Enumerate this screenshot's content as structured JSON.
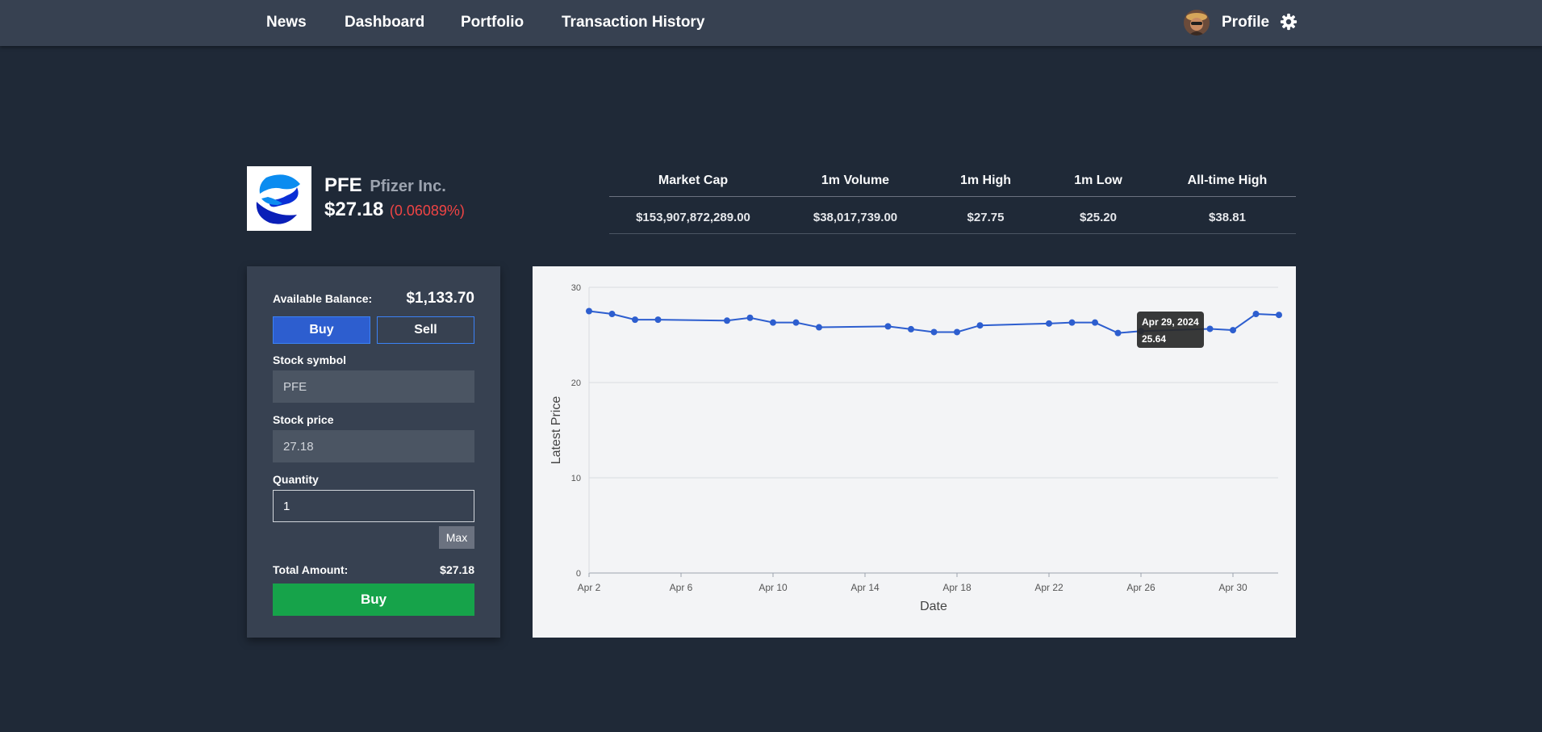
{
  "nav": {
    "links": [
      "News",
      "Dashboard",
      "Portfolio",
      "Transaction History"
    ],
    "profile_label": "Profile",
    "avatar_icon": "avatar-icon",
    "settings_icon": "gear-icon"
  },
  "stock": {
    "symbol": "PFE",
    "company": "Pfizer Inc.",
    "price": "$27.18",
    "change": "(0.06089%)",
    "change_color": "#ef4444",
    "logo_icon": "pfizer-logo"
  },
  "stats": {
    "headers": [
      "Market Cap",
      "1m Volume",
      "1m High",
      "1m Low",
      "All-time High"
    ],
    "values": [
      "$153,907,872,289.00",
      "$38,017,739.00",
      "$27.75",
      "$25.20",
      "$38.81"
    ]
  },
  "trade": {
    "balance_label": "Available Balance:",
    "balance_value": "$1,133.70",
    "tab_buy": "Buy",
    "tab_sell": "Sell",
    "symbol_label": "Stock symbol",
    "symbol_value": "PFE",
    "price_label": "Stock price",
    "price_value": "27.18",
    "quantity_label": "Quantity",
    "quantity_value": "1",
    "max_label": "Max",
    "total_label": "Total Amount:",
    "total_value": "$27.18",
    "submit_label": "Buy",
    "accent_color": "#2d5ecf",
    "submit_color": "#16a34a"
  },
  "chart_data": {
    "type": "line",
    "xlabel": "Date",
    "ylabel": "Latest Price",
    "ylim": [
      0,
      30
    ],
    "yticks": [
      0,
      10,
      20,
      30
    ],
    "xticks": [
      "Apr 2",
      "Apr 6",
      "Apr 10",
      "Apr 14",
      "Apr 18",
      "Apr 22",
      "Apr 26",
      "Apr 30"
    ],
    "grid": true,
    "line_color": "#2d5ecf",
    "series": [
      {
        "x": [
          "2024-04-02",
          "2024-04-03",
          "2024-04-04",
          "2024-04-05",
          "2024-04-08",
          "2024-04-09",
          "2024-04-10",
          "2024-04-11",
          "2024-04-12",
          "2024-04-15",
          "2024-04-16",
          "2024-04-17",
          "2024-04-18",
          "2024-04-19",
          "2024-04-22",
          "2024-04-23",
          "2024-04-24",
          "2024-04-25",
          "2024-04-26",
          "2024-04-29",
          "2024-04-30",
          "2024-05-01",
          "2024-05-02"
        ],
        "values": [
          27.5,
          27.2,
          26.6,
          26.6,
          26.5,
          26.8,
          26.3,
          26.3,
          25.8,
          25.9,
          25.6,
          25.3,
          25.3,
          26.0,
          26.2,
          26.3,
          26.3,
          25.2,
          25.4,
          25.64,
          25.5,
          27.2,
          27.1
        ]
      }
    ],
    "tooltip": {
      "date": "Apr 29, 2024",
      "value": "25.64"
    }
  }
}
